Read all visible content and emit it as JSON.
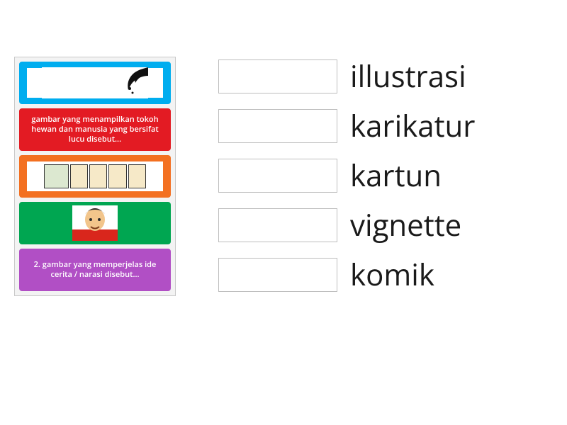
{
  "source_cards": [
    {
      "id": "card-vignette",
      "color": "blue",
      "kind": "image",
      "alt": "vignette corner ornament thumbnail",
      "text": ""
    },
    {
      "id": "card-kartun",
      "color": "red",
      "kind": "text",
      "text": "gambar yang menampilkan tokoh hewan dan manusia yang bersifat lucu disebut..."
    },
    {
      "id": "card-komik",
      "color": "orange",
      "kind": "image",
      "alt": "comic strip thumbnail",
      "text": ""
    },
    {
      "id": "card-karikatur",
      "color": "green",
      "kind": "image",
      "alt": "caricature portrait thumbnail",
      "text": ""
    },
    {
      "id": "card-ilustrasi",
      "color": "purple",
      "kind": "text",
      "text": "2. gambar yang memperjelas ide cerita / narasi disebut..."
    }
  ],
  "answers": [
    {
      "label": "illustrasi"
    },
    {
      "label": "karikatur"
    },
    {
      "label": "kartun"
    },
    {
      "label": "vignette"
    },
    {
      "label": "komik"
    }
  ]
}
